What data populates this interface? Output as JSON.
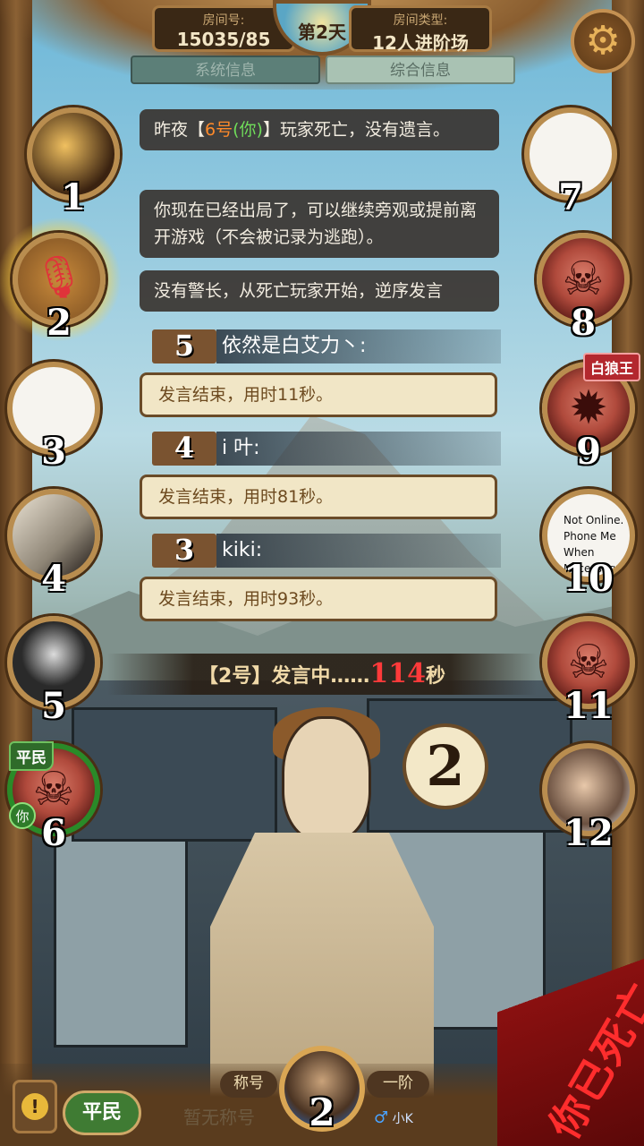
{
  "room": {
    "id_label": "房间号:",
    "id_value": "15035/85",
    "type_label": "房间类型:",
    "type_value": "12人进阶场"
  },
  "day": "第2天",
  "tabs": {
    "system": "系统信息",
    "all": "综合信息"
  },
  "players": {
    "p1": "1",
    "p2": "2",
    "p3": "3",
    "p4": "4",
    "p5": "5",
    "p6": "6",
    "p7": "7",
    "p8": "8",
    "p9": "9",
    "p10": "10",
    "p11": "11",
    "p12": "12"
  },
  "tags": {
    "p6_role": "平民",
    "p6_you": "你",
    "p9_role": "白狼王",
    "p10_status": "Not Online. Phone Me When Necessary."
  },
  "messages": {
    "m1_a": "昨夜【",
    "m1_b": "6号",
    "m1_c": "(你)",
    "m1_d": "】玩家死亡，没有遗言。",
    "m2": "你现在已经出局了，可以继续旁观或提前离开游戏（不会被记录为逃跑）。",
    "m3": "没有警长，从死亡玩家开始，逆序发言"
  },
  "speeches": [
    {
      "num": "5",
      "name": "依然是白艾力丶:",
      "end": "发言结束，用时11秒。"
    },
    {
      "num": "4",
      "name": "i 叶:",
      "end": "发言结束，用时81秒。"
    },
    {
      "num": "3",
      "name": "kiki:",
      "end": "发言结束，用时93秒。"
    }
  ],
  "countdown": {
    "prefix": "【2号】发言中……",
    "seconds": "114",
    "suffix": "秒"
  },
  "current_speaker": "2",
  "bottom": {
    "alert": "!",
    "role": "平民",
    "title_label": "称号",
    "title_value": "暂无称号",
    "rank": "一阶",
    "self_num": "2",
    "self_name": "小K",
    "gender": "♂"
  },
  "dead_stamp": "你已死亡",
  "icons": {
    "settings": "gear-icon",
    "mic": "microphone-icon",
    "skull": "skull-icon"
  },
  "colors": {
    "accent_red": "#ff3a3a",
    "frame_gold": "#b98d4f",
    "civilian_green": "#3f7b33"
  }
}
